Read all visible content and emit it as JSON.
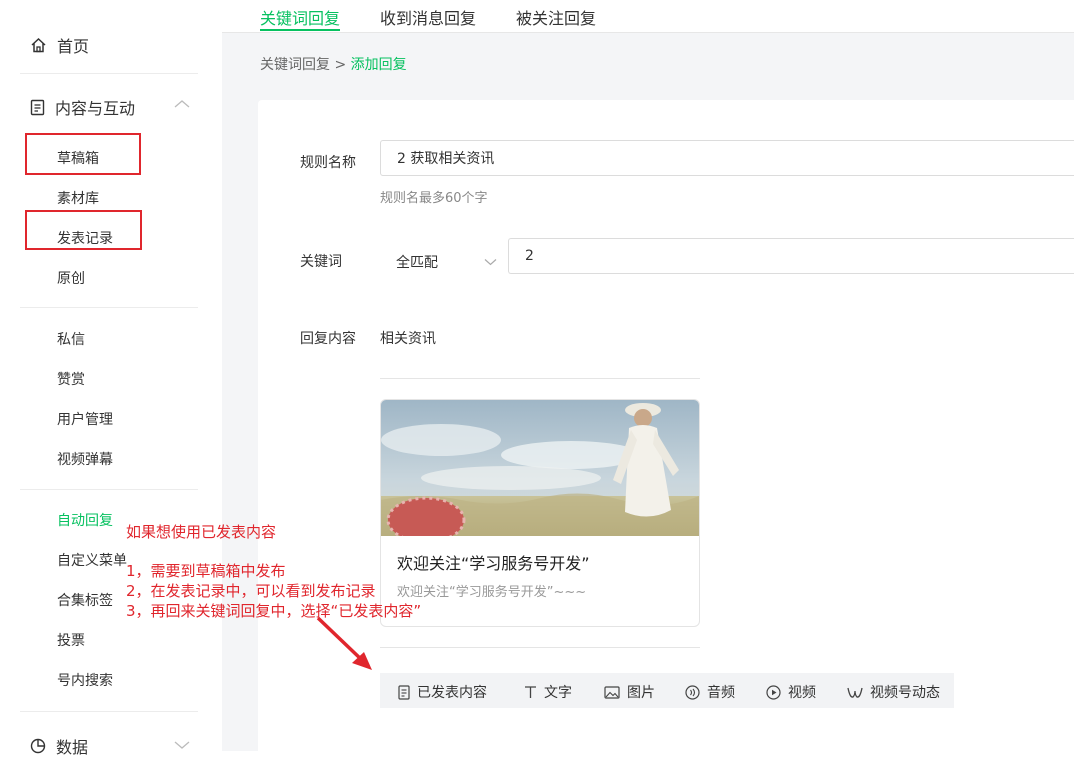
{
  "sidebar": {
    "home": "首页",
    "section": "内容与互动",
    "items": [
      "草稿箱",
      "素材库",
      "发表记录",
      "原创",
      "私信",
      "赞赏",
      "用户管理",
      "视频弹幕",
      "自动回复",
      "自定义菜单",
      "合集标签",
      "投票",
      "号内搜索"
    ],
    "bottom": "数据"
  },
  "tabs": [
    "关键词回复",
    "收到消息回复",
    "被关注回复"
  ],
  "breadcrumb": {
    "parent": "关键词回复",
    "sep": ">",
    "current": "添加回复"
  },
  "form": {
    "rule_name_label": "规则名称",
    "rule_name_value": "2 获取相关资讯",
    "rule_name_hint": "规则名最多60个字",
    "keyword_label": "关键词",
    "match_mode": "全匹配",
    "keyword_value": "2",
    "reply_label": "回复内容",
    "reply_text": "相关资讯"
  },
  "article": {
    "title": "欢迎关注“学习服务号开发”",
    "digest": "欢迎关注“学习服务号开发”~~~"
  },
  "toolbar": [
    "已发表内容",
    "文字",
    "图片",
    "音频",
    "视频",
    "视频号动态"
  ],
  "annotation": {
    "heading": "如果想使用已发表内容",
    "steps": [
      "1，需要到草稿箱中发布",
      "2，在发表记录中，可以看到发布记录",
      "3，再回来关键词回复中，选择“已发表内容”"
    ]
  },
  "colors": {
    "accent": "#07c160",
    "annotation": "#e0262d"
  }
}
